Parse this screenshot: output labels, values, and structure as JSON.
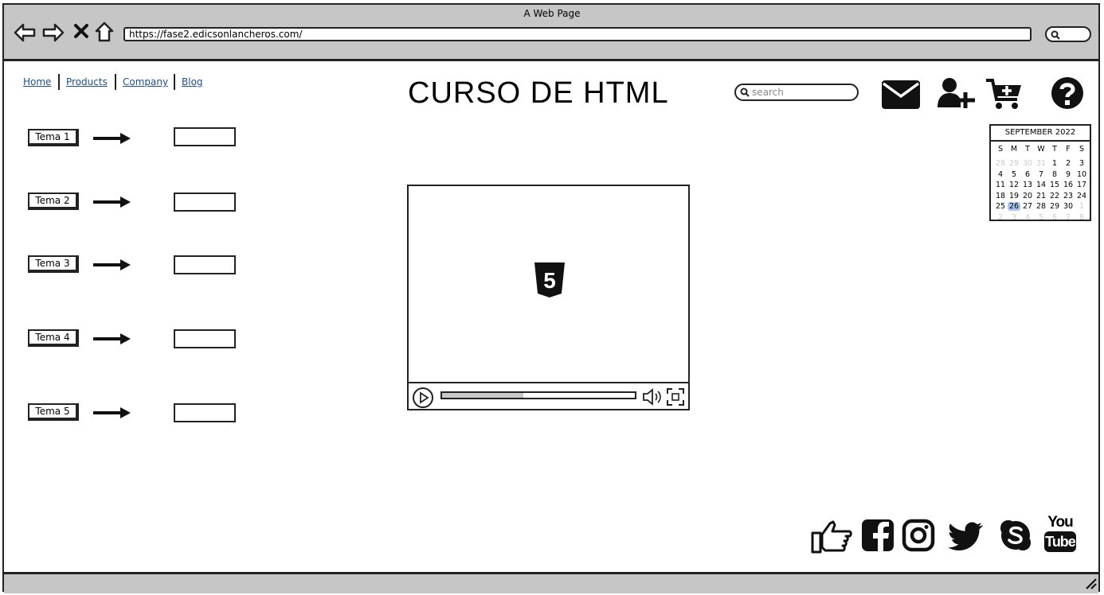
{
  "window": {
    "title": "A Web Page",
    "url": "https://fase2.edicsonlancheros.com/"
  },
  "nav": {
    "items": [
      {
        "label": "Home"
      },
      {
        "label": "Products"
      },
      {
        "label": "Company"
      },
      {
        "label": "Blog"
      }
    ]
  },
  "header": {
    "title": "CURSO DE HTML",
    "search_placeholder": "search"
  },
  "header_icons": [
    "mail-icon",
    "add-user-icon",
    "add-to-cart-icon",
    "help-icon"
  ],
  "temas": [
    {
      "label": "Tema 1"
    },
    {
      "label": "Tema 2"
    },
    {
      "label": "Tema 3"
    },
    {
      "label": "Tema 4"
    },
    {
      "label": "Tema 5"
    }
  ],
  "video": {
    "logo_text": "5",
    "progress_percent": 42
  },
  "calendar": {
    "month": "SEPTEMBER 2022",
    "weekdays": [
      "S",
      "M",
      "T",
      "W",
      "T",
      "F",
      "S"
    ],
    "weeks": [
      [
        "28",
        "29",
        "30",
        "31",
        "1",
        "2",
        "3"
      ],
      [
        "4",
        "5",
        "6",
        "7",
        "8",
        "9",
        "10"
      ],
      [
        "11",
        "12",
        "13",
        "14",
        "15",
        "16",
        "17"
      ],
      [
        "18",
        "19",
        "20",
        "21",
        "22",
        "23",
        "24"
      ],
      [
        "25",
        "26",
        "27",
        "28",
        "29",
        "30",
        "1"
      ],
      [
        "2",
        "3",
        "4",
        "5",
        "6",
        "7",
        "8"
      ]
    ],
    "selected_day": "26"
  },
  "social": {
    "youtube_you": "You",
    "youtube_tube": "Tube",
    "icons": [
      "thumbs-up-icon",
      "facebook-icon",
      "instagram-icon",
      "twitter-icon",
      "skype-icon",
      "youtube-icon"
    ]
  }
}
